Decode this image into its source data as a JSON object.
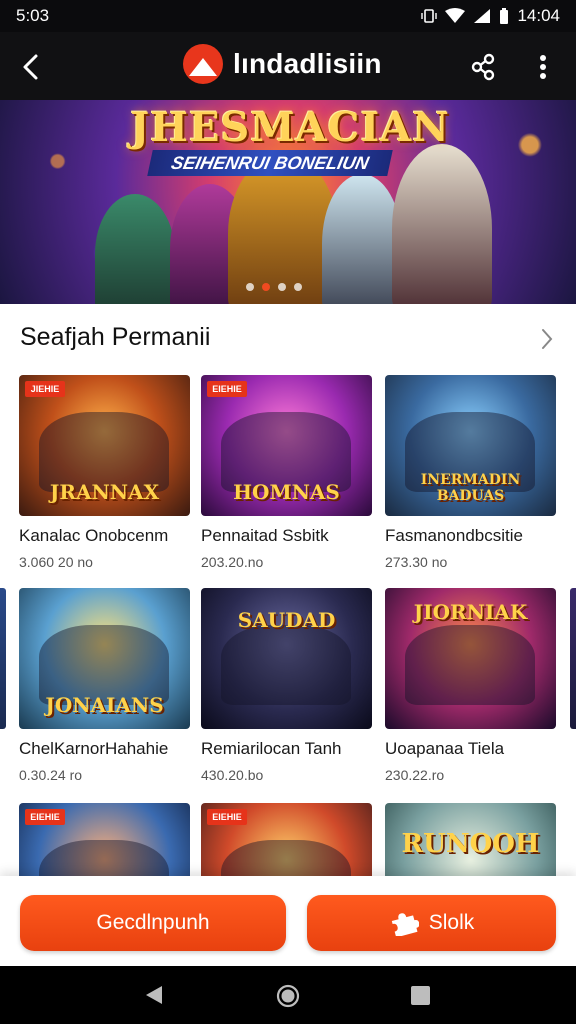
{
  "status_bar": {
    "time": "5:03",
    "clock": "14:04"
  },
  "app_bar": {
    "title": "lındadlisiin"
  },
  "banner": {
    "title": "JHESMACIAN",
    "subtitle": "SEIHENRUI BONELIUN",
    "dots": 4,
    "active_dot": 1
  },
  "section": {
    "title": "Seafjah Permanii"
  },
  "games": [
    {
      "thumb_title": "JRANNAX",
      "badge": "JIEHIE",
      "name": "Kanalac Onobcenm",
      "meta": "3.060 20 no"
    },
    {
      "thumb_title": "HOMNAS",
      "badge": "EIEHIE",
      "name": "Pennaitad Ssbitk",
      "meta": "203.20.no"
    },
    {
      "thumb_title": "INERMADIN BADUAS",
      "badge": "",
      "name": "Fasmanondbcsitie",
      "meta": "273.30 no"
    },
    {
      "thumb_title": "JONAIANS",
      "badge": "",
      "name": "ChelKarnorHahahie",
      "meta": "0.30.24 ro"
    },
    {
      "thumb_title": "SAUDAD",
      "badge": "",
      "name": "Remiarilocan Tanh",
      "meta": "430.20.bo"
    },
    {
      "thumb_title": "JIORNIAK",
      "badge": "",
      "name": "Uoapanaa Tiela",
      "meta": "230.22.ro"
    },
    {
      "thumb_title": "",
      "badge": "EIEHIE",
      "name": "",
      "meta": ""
    },
    {
      "thumb_title": "",
      "badge": "EIEHIE",
      "name": "",
      "meta": ""
    },
    {
      "thumb_title": "RUNOOH",
      "badge": "",
      "name": "",
      "meta": ""
    }
  ],
  "actions": {
    "primary_label": "Gecdlnpunh",
    "secondary_label": "Slolk"
  },
  "icons": [
    "back-arrow-icon",
    "logo-icon",
    "share-icon",
    "more-vert-icon",
    "chevron-right-icon",
    "puzzle-icon",
    "nav-back-icon",
    "nav-home-icon",
    "nav-recent-icon"
  ],
  "colors": {
    "accent": "#e8410f",
    "app_bar": "#111113"
  }
}
